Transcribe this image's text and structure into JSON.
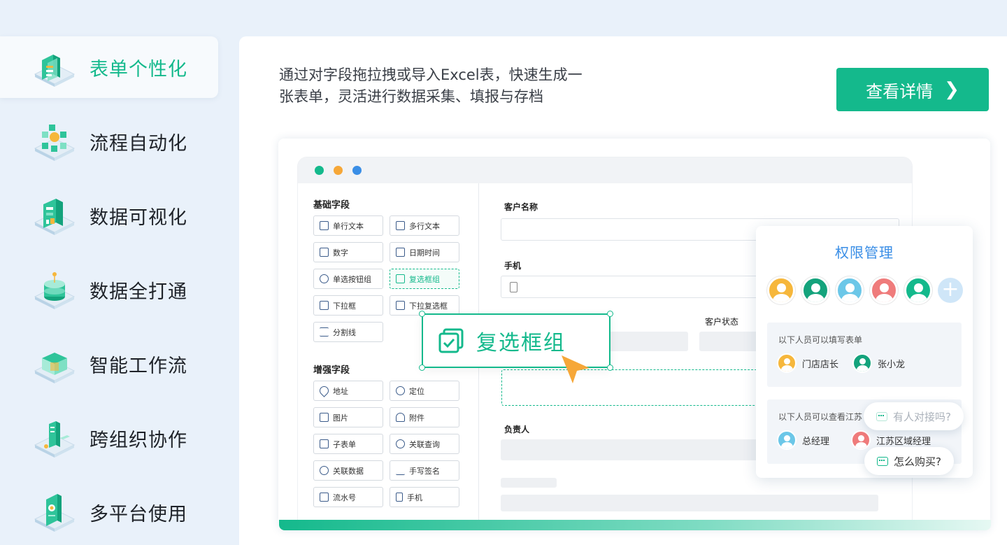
{
  "sidebar": {
    "items": [
      {
        "label": "表单个性化",
        "icon": "form-icon",
        "active": true
      },
      {
        "label": "流程自动化",
        "icon": "process-icon",
        "active": false
      },
      {
        "label": "数据可视化",
        "icon": "chart-icon",
        "active": false
      },
      {
        "label": "数据全打通",
        "icon": "database-icon",
        "active": false
      },
      {
        "label": "智能工作流",
        "icon": "workflow-icon",
        "active": false
      },
      {
        "label": "跨组织协作",
        "icon": "collaboration-icon",
        "active": false
      },
      {
        "label": "多平台使用",
        "icon": "multi-platform-icon",
        "active": false
      }
    ]
  },
  "main": {
    "description": "通过对字段拖拉拽或导入Excel表，快速生成一张表单，灵活进行数据采集、填报与存档",
    "cta_label": "查看详情",
    "accent": "#14b98c"
  },
  "builder": {
    "basic_title": "基础字段",
    "basic_fields": [
      "单行文本",
      "多行文本",
      "数字",
      "日期时间",
      "单选按钮组",
      "复选框组",
      "下拉框",
      "下拉复选框",
      "分割线"
    ],
    "enhanced_title": "增强字段",
    "enhanced_fields": [
      "地址",
      "定位",
      "图片",
      "附件",
      "子表单",
      "关联查询",
      "关联数据",
      "手写签名",
      "流水号",
      "手机"
    ],
    "form_labels": {
      "customer_name": "客户名称",
      "phone": "手机",
      "customer_status": "客户状态",
      "owner": "负责人"
    },
    "drag_label": "复选框组"
  },
  "permission": {
    "title": "权限管理",
    "fill_title": "以下人员可以填写表单",
    "fill_people": [
      "门店店长",
      "张小龙"
    ],
    "view_title": "以下人员可以查看江苏",
    "view_people": [
      "总经理",
      "江苏区域经理"
    ]
  },
  "chat": {
    "ask_contact": "有人对接吗?",
    "ask_buy": "怎么购买?"
  }
}
